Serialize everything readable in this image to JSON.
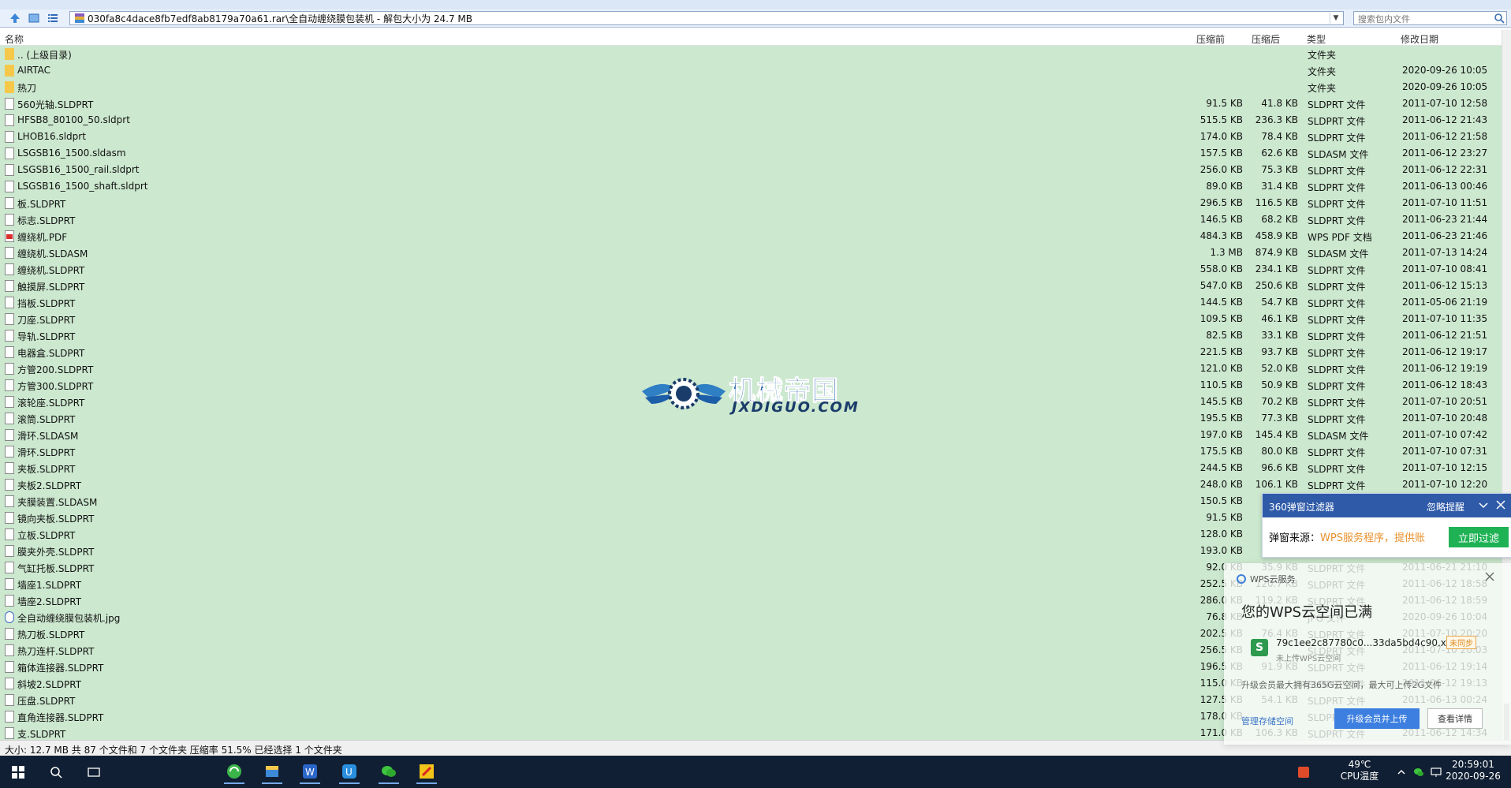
{
  "address": {
    "path": "030fa8c4dace8fb7edf8ab8179a70a61.rar\\全自动缠绕膜包装机 - 解包大小为 24.7 MB",
    "search_placeholder": "搜索包内文件"
  },
  "columns": {
    "name": "名称",
    "before": "压缩前",
    "after": "压缩后",
    "type": "类型",
    "date": "修改日期"
  },
  "files": [
    {
      "name": ".. (上级目录)",
      "before": "",
      "after": "",
      "type": "文件夹",
      "date": "",
      "icon": "folder"
    },
    {
      "name": "AIRTAC",
      "before": "",
      "after": "",
      "type": "文件夹",
      "date": "2020-09-26 10:05",
      "icon": "folder"
    },
    {
      "name": "热刀",
      "before": "",
      "after": "",
      "type": "文件夹",
      "date": "2020-09-26 10:05",
      "icon": "folder"
    },
    {
      "name": "560光轴.SLDPRT",
      "before": "91.5 KB",
      "after": "41.8 KB",
      "type": "SLDPRT 文件",
      "date": "2011-07-10 12:58",
      "icon": "doc"
    },
    {
      "name": "HFSB8_80100_50.sldprt",
      "before": "515.5 KB",
      "after": "236.3 KB",
      "type": "SLDPRT 文件",
      "date": "2011-06-12 21:43",
      "icon": "doc"
    },
    {
      "name": "LHOB16.sldprt",
      "before": "174.0 KB",
      "after": "78.4 KB",
      "type": "SLDPRT 文件",
      "date": "2011-06-12 21:58",
      "icon": "doc"
    },
    {
      "name": "LSGSB16_1500.sldasm",
      "before": "157.5 KB",
      "after": "62.6 KB",
      "type": "SLDASM 文件",
      "date": "2011-06-12 23:27",
      "icon": "doc"
    },
    {
      "name": "LSGSB16_1500_rail.sldprt",
      "before": "256.0 KB",
      "after": "75.3 KB",
      "type": "SLDPRT 文件",
      "date": "2011-06-12 22:31",
      "icon": "doc"
    },
    {
      "name": "LSGSB16_1500_shaft.sldprt",
      "before": "89.0 KB",
      "after": "31.4 KB",
      "type": "SLDPRT 文件",
      "date": "2011-06-13 00:46",
      "icon": "doc"
    },
    {
      "name": "板.SLDPRT",
      "before": "296.5 KB",
      "after": "116.5 KB",
      "type": "SLDPRT 文件",
      "date": "2011-07-10 11:51",
      "icon": "doc"
    },
    {
      "name": "标志.SLDPRT",
      "before": "146.5 KB",
      "after": "68.2 KB",
      "type": "SLDPRT 文件",
      "date": "2011-06-23 21:44",
      "icon": "doc"
    },
    {
      "name": "缠绕机.PDF",
      "before": "484.3 KB",
      "after": "458.9 KB",
      "type": "WPS PDF 文档",
      "date": "2011-06-23 21:46",
      "icon": "pdf"
    },
    {
      "name": "缠绕机.SLDASM",
      "before": "1.3 MB",
      "after": "874.9 KB",
      "type": "SLDASM 文件",
      "date": "2011-07-13 14:24",
      "icon": "doc"
    },
    {
      "name": "缠绕机.SLDPRT",
      "before": "558.0 KB",
      "after": "234.1 KB",
      "type": "SLDPRT 文件",
      "date": "2011-07-10 08:41",
      "icon": "doc"
    },
    {
      "name": "触摸屏.SLDPRT",
      "before": "547.0 KB",
      "after": "250.6 KB",
      "type": "SLDPRT 文件",
      "date": "2011-06-12 15:13",
      "icon": "doc"
    },
    {
      "name": "挡板.SLDPRT",
      "before": "144.5 KB",
      "after": "54.7 KB",
      "type": "SLDPRT 文件",
      "date": "2011-05-06 21:19",
      "icon": "doc"
    },
    {
      "name": "刀座.SLDPRT",
      "before": "109.5 KB",
      "after": "46.1 KB",
      "type": "SLDPRT 文件",
      "date": "2011-07-10 11:35",
      "icon": "doc"
    },
    {
      "name": "导轨.SLDPRT",
      "before": "82.5 KB",
      "after": "33.1 KB",
      "type": "SLDPRT 文件",
      "date": "2011-06-12 21:51",
      "icon": "doc"
    },
    {
      "name": "电器盒.SLDPRT",
      "before": "221.5 KB",
      "after": "93.7 KB",
      "type": "SLDPRT 文件",
      "date": "2011-06-12 19:17",
      "icon": "doc"
    },
    {
      "name": "方管200.SLDPRT",
      "before": "121.0 KB",
      "after": "52.0 KB",
      "type": "SLDPRT 文件",
      "date": "2011-06-12 19:19",
      "icon": "doc"
    },
    {
      "name": "方管300.SLDPRT",
      "before": "110.5 KB",
      "after": "50.9 KB",
      "type": "SLDPRT 文件",
      "date": "2011-06-12 18:43",
      "icon": "doc"
    },
    {
      "name": "滚轮座.SLDPRT",
      "before": "145.5 KB",
      "after": "70.2 KB",
      "type": "SLDPRT 文件",
      "date": "2011-07-10 20:51",
      "icon": "doc"
    },
    {
      "name": "滚筒.SLDPRT",
      "before": "195.5 KB",
      "after": "77.3 KB",
      "type": "SLDPRT 文件",
      "date": "2011-07-10 20:48",
      "icon": "doc"
    },
    {
      "name": "滑环.SLDASM",
      "before": "197.0 KB",
      "after": "145.4 KB",
      "type": "SLDASM 文件",
      "date": "2011-07-10 07:42",
      "icon": "doc"
    },
    {
      "name": "滑环.SLDPRT",
      "before": "175.5 KB",
      "after": "80.0 KB",
      "type": "SLDPRT 文件",
      "date": "2011-07-10 07:31",
      "icon": "doc"
    },
    {
      "name": "夹板.SLDPRT",
      "before": "244.5 KB",
      "after": "96.6 KB",
      "type": "SLDPRT 文件",
      "date": "2011-07-10 12:15",
      "icon": "doc"
    },
    {
      "name": "夹板2.SLDPRT",
      "before": "248.0 KB",
      "after": "106.1 KB",
      "type": "SLDPRT 文件",
      "date": "2011-07-10 12:20",
      "icon": "doc"
    },
    {
      "name": "夹膜装置.SLDASM",
      "before": "150.5 KB",
      "after": "",
      "type": "",
      "date": "",
      "icon": "doc"
    },
    {
      "name": "镜向夹板.SLDPRT",
      "before": "91.5 KB",
      "after": "",
      "type": "",
      "date": "",
      "icon": "doc"
    },
    {
      "name": "立板.SLDPRT",
      "before": "128.0 KB",
      "after": "",
      "type": "",
      "date": "",
      "icon": "doc"
    },
    {
      "name": "膜夹外壳.SLDPRT",
      "before": "193.0 KB",
      "after": "",
      "type": "",
      "date": "",
      "icon": "doc"
    },
    {
      "name": "气缸托板.SLDPRT",
      "before": "92.0 KB",
      "after": "35.9 KB",
      "type": "SLDPRT 文件",
      "date": "2011-06-21 21:10",
      "icon": "doc"
    },
    {
      "name": "墙座1.SLDPRT",
      "before": "252.5 KB",
      "after": "120.7 KB",
      "type": "SLDPRT 文件",
      "date": "2011-06-12 18:58",
      "icon": "doc"
    },
    {
      "name": "墙座2.SLDPRT",
      "before": "286.0 KB",
      "after": "119.2 KB",
      "type": "SLDPRT 文件",
      "date": "2011-06-12 18:59",
      "icon": "doc"
    },
    {
      "name": "全自动缠绕膜包装机.jpg",
      "before": "76.8 KB",
      "after": "",
      "type": "JPG 文件",
      "date": "2020-09-26 10:04",
      "icon": "jpg"
    },
    {
      "name": "热刀板.SLDPRT",
      "before": "202.5 KB",
      "after": "76.4 KB",
      "type": "SLDPRT 文件",
      "date": "2011-07-10 20:20",
      "icon": "doc"
    },
    {
      "name": "热刀连杆.SLDPRT",
      "before": "256.5 KB",
      "after": "",
      "type": "SLDPRT 文件",
      "date": "2011-07-10 20:03",
      "icon": "doc"
    },
    {
      "name": "箱体连接器.SLDPRT",
      "before": "196.5 KB",
      "after": "91.9 KB",
      "type": "SLDPRT 文件",
      "date": "2011-06-12 19:14",
      "icon": "doc"
    },
    {
      "name": "斜坡2.SLDPRT",
      "before": "115.0 KB",
      "after": "",
      "type": "SLDPRT 文件",
      "date": "2011-06-12 19:13",
      "icon": "doc"
    },
    {
      "name": "压盘.SLDPRT",
      "before": "127.5 KB",
      "after": "54.1 KB",
      "type": "SLDPRT 文件",
      "date": "2011-06-13 00:24",
      "icon": "doc"
    },
    {
      "name": "直角连接器.SLDPRT",
      "before": "178.0 KB",
      "after": "",
      "type": "SLDPRT 文件",
      "date": "",
      "icon": "doc"
    },
    {
      "name": "支.SLDPRT",
      "before": "171.0 KB",
      "after": "106.3 KB",
      "type": "SLDPRT 文件",
      "date": "2011-06-12 14:34",
      "icon": "doc"
    }
  ],
  "watermark": {
    "cn": "机械帝国",
    "en": "JXDIGUO.COM"
  },
  "status": "大小: 12.7 MB 共 87 个文件和 7 个文件夹 压缩率 51.5% 已经选择 1 个文件夹",
  "popup360": {
    "title": "360弹窗过滤器",
    "ignore": "忽略提醒",
    "source_label": "弹窗来源：",
    "source_value": "WPS服务程序，提供账",
    "filter_button": "立即过滤"
  },
  "wps": {
    "brand": "WPS云服务",
    "title": "您的WPS云空间已满",
    "file_name": "79c1ee2c87780c0...33da5bd4c90.xls",
    "file_tag": "未同步",
    "file_sub": "未上传WPS云空间",
    "desc": "升级会员最大拥有365G云空间，最大可上传2G文件",
    "manage": "管理存储空间",
    "upgrade": "升级会员并上传",
    "detail": "查看详情"
  },
  "taskbar": {
    "temp": "49℃",
    "temp_label": "CPU温度",
    "time": "20:59:01",
    "date": "2020-09-26"
  }
}
